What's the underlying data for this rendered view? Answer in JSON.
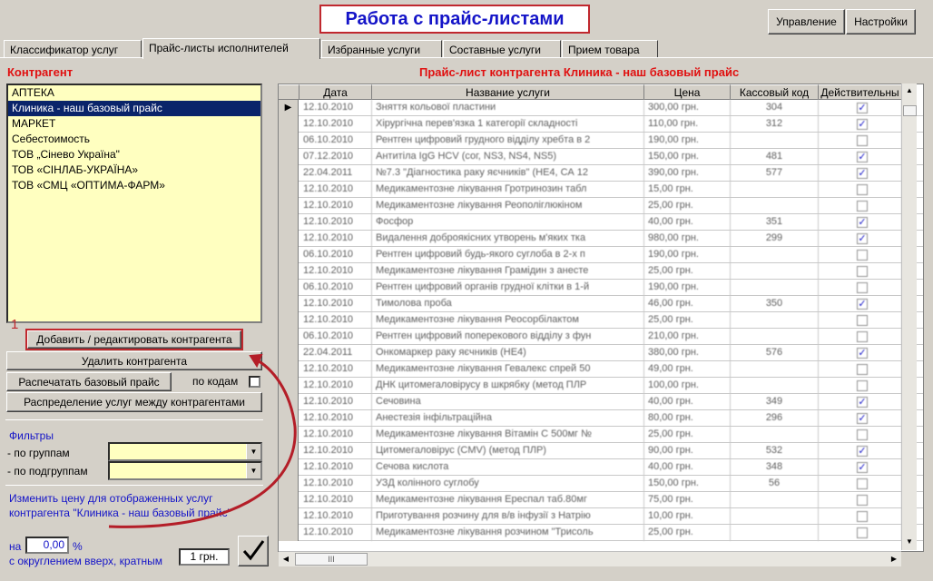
{
  "title": "Работа с прайс-листами",
  "top_buttons": {
    "manage": "Управление",
    "settings": "Настройки"
  },
  "tabs": [
    "Классификатор услуг",
    "Прайс-листы исполнителей",
    "Избранные услуги",
    "Составные услуги",
    "Прием товара"
  ],
  "left": {
    "section_title": "Контрагент",
    "counterparties": [
      "АПТЕКА",
      "Клиника - наш базовый прайс",
      "МАРКЕТ",
      "Себестоимость",
      "ТОВ „Сінево Україна\"",
      "ТОВ «СІНЛАБ-УКРАЇНА»",
      "ТОВ «СМЦ «ОПТИМА-ФАРМ»"
    ],
    "selected_index": 1,
    "annotation_number": "1",
    "add_edit_button": "Добавить / редактировать контрагента",
    "delete_button": "Удалить контрагента",
    "print_button": "Распечатать базовый прайс",
    "by_codes_label": "по кодам",
    "distribute_button": "Распределение услуг между контрагентами",
    "filters_title": "Фильтры",
    "filter_groups_label": "- по группам",
    "filter_subgroups_label": "- по подгруппам",
    "change_price_text_1": "Изменить цену для отображенных услуг",
    "change_price_text_2": "контрагента \"Клиника - наш базовый прайс\"",
    "on_label": "на",
    "percent_value": "0,00",
    "percent_sign": "%",
    "rounding_label": "с округлением вверх, кратным",
    "rounding_value": "1 грн.",
    "apply_icon": "checkmark-icon"
  },
  "grid": {
    "section_title": "Прайс-лист контрагента Клиника - наш базовый прайс",
    "columns": [
      "Дата",
      "Название услуги",
      "Цена",
      "Кассовый код",
      "Действительны"
    ],
    "rows": [
      {
        "date": "12.10.2010",
        "name": "Зняття кольової пластини",
        "price": "300,00 грн.",
        "code": "304",
        "active": true
      },
      {
        "date": "12.10.2010",
        "name": "Хірургічна перев'язка 1 категорії складності",
        "price": "110,00 грн.",
        "code": "312",
        "active": true
      },
      {
        "date": "06.10.2010",
        "name": "Рентген цифровий грудного відділу хребта в 2",
        "price": "190,00 грн.",
        "code": "",
        "active": false
      },
      {
        "date": "07.12.2010",
        "name": "Антитіла IgG HCV (сог, NS3, NS4, NS5)",
        "price": "150,00 грн.",
        "code": "481",
        "active": true
      },
      {
        "date": "22.04.2011",
        "name": "№7.3 \"Діагностика раку яєчників\" (НЕ4, СА 12",
        "price": "390,00 грн.",
        "code": "577",
        "active": true
      },
      {
        "date": "12.10.2010",
        "name": "Медикаментозне лікування Гротринозин табл",
        "price": "15,00 грн.",
        "code": "",
        "active": false
      },
      {
        "date": "12.10.2010",
        "name": "Медикаментозне лікування Реополіглюкіном",
        "price": "25,00 грн.",
        "code": "",
        "active": false
      },
      {
        "date": "12.10.2010",
        "name": "Фосфор",
        "price": "40,00 грн.",
        "code": "351",
        "active": true
      },
      {
        "date": "12.10.2010",
        "name": "Видалення доброякісних утворень м'яких тка",
        "price": "980,00 грн.",
        "code": "299",
        "active": true
      },
      {
        "date": "06.10.2010",
        "name": "Рентген цифровий будь-якого суглоба в 2-х п",
        "price": "190,00 грн.",
        "code": "",
        "active": false
      },
      {
        "date": "12.10.2010",
        "name": "Медикаментозне лікування Грамідин з анесте",
        "price": "25,00 грн.",
        "code": "",
        "active": false
      },
      {
        "date": "06.10.2010",
        "name": "Рентген цифровий органів грудної клітки в 1-й",
        "price": "190,00 грн.",
        "code": "",
        "active": false
      },
      {
        "date": "12.10.2010",
        "name": "Тимолова проба",
        "price": "46,00 грн.",
        "code": "350",
        "active": true
      },
      {
        "date": "12.10.2010",
        "name": "Медикаментозне лікування Реосорбілактом",
        "price": "25,00 грн.",
        "code": "",
        "active": false
      },
      {
        "date": "06.10.2010",
        "name": "Рентген цифровий поперекового відділу з фун",
        "price": "210,00 грн.",
        "code": "",
        "active": false
      },
      {
        "date": "22.04.2011",
        "name": "Онкомаркер раку яєчників (НЕ4)",
        "price": "380,00 грн.",
        "code": "576",
        "active": true
      },
      {
        "date": "12.10.2010",
        "name": "Медикаментозне лікування Гевалекс спрей 50",
        "price": "49,00 грн.",
        "code": "",
        "active": false
      },
      {
        "date": "12.10.2010",
        "name": "ДНК цитомегаловірусу в шкрябку (метод ПЛР",
        "price": "100,00 грн.",
        "code": "",
        "active": false
      },
      {
        "date": "12.10.2010",
        "name": "Сечовина",
        "price": "40,00 грн.",
        "code": "349",
        "active": true
      },
      {
        "date": "12.10.2010",
        "name": "Анестезія інфільтраційна",
        "price": "80,00 грн.",
        "code": "296",
        "active": true
      },
      {
        "date": "12.10.2010",
        "name": "Медикаментозне лікування Вітамін С 500мг №",
        "price": "25,00 грн.",
        "code": "",
        "active": false
      },
      {
        "date": "12.10.2010",
        "name": "Цитомегаловірус (CMV) (метод ПЛР)",
        "price": "90,00 грн.",
        "code": "532",
        "active": true
      },
      {
        "date": "12.10.2010",
        "name": "Сечова кислота",
        "price": "40,00 грн.",
        "code": "348",
        "active": true
      },
      {
        "date": "12.10.2010",
        "name": "УЗД колінного суглобу",
        "price": "150,00 грн.",
        "code": "56",
        "active": false
      },
      {
        "date": "12.10.2010",
        "name": "Медикаментозне лікування Ереспал таб.80мг",
        "price": "75,00 грн.",
        "code": "",
        "active": false
      },
      {
        "date": "12.10.2010",
        "name": "Приготування розчину для в/в інфузії з Натрію",
        "price": "10,00 грн.",
        "code": "",
        "active": false
      },
      {
        "date": "12.10.2010",
        "name": "Медикаментозне лікування розчином \"Трисоль",
        "price": "25,00 грн.",
        "code": "",
        "active": false
      }
    ],
    "hscroll_grip": "III"
  }
}
